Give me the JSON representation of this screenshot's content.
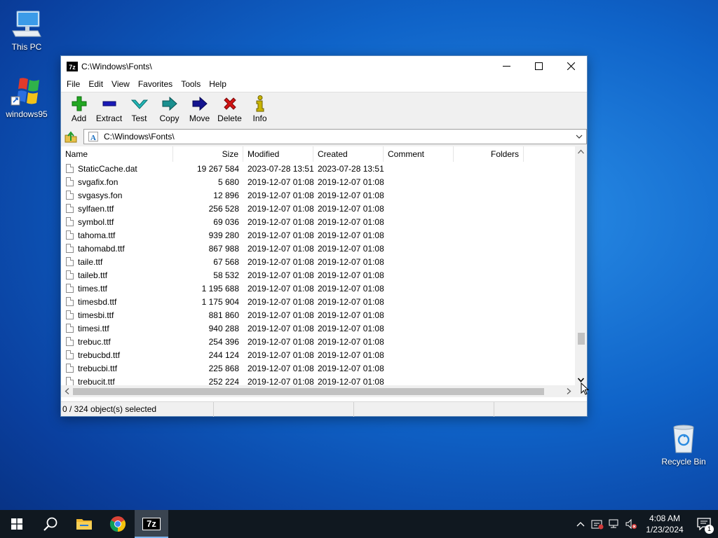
{
  "desktop": {
    "icons": [
      {
        "label": "This PC"
      },
      {
        "label": "windows95"
      },
      {
        "label": "Recycle Bin"
      }
    ]
  },
  "window": {
    "title": "C:\\Windows\\Fonts\\",
    "app_icon_text": "7z",
    "menu": [
      "File",
      "Edit",
      "View",
      "Favorites",
      "Tools",
      "Help"
    ],
    "toolbar": [
      {
        "label": "Add",
        "icon": "plus-icon",
        "color": "#22a822"
      },
      {
        "label": "Extract",
        "icon": "minus-icon",
        "color": "#1a1ab8"
      },
      {
        "label": "Test",
        "icon": "check-icon",
        "color": "#23b8b8"
      },
      {
        "label": "Copy",
        "icon": "copy-arrow-icon",
        "color": "#1a8f8f"
      },
      {
        "label": "Move",
        "icon": "move-arrow-icon",
        "color": "#14148f"
      },
      {
        "label": "Delete",
        "icon": "x-icon",
        "color": "#d21414"
      },
      {
        "label": "Info",
        "icon": "info-icon",
        "color": "#c9b400"
      }
    ],
    "address": "C:\\Windows\\Fonts\\",
    "columns": [
      "Name",
      "Size",
      "Modified",
      "Created",
      "Comment",
      "Folders"
    ],
    "rows": [
      {
        "name": "StaticCache.dat",
        "size": "19 267 584",
        "modified": "2023-07-28 13:51",
        "created": "2023-07-28 13:51"
      },
      {
        "name": "svgafix.fon",
        "size": "5 680",
        "modified": "2019-12-07 01:08",
        "created": "2019-12-07 01:08"
      },
      {
        "name": "svgasys.fon",
        "size": "12 896",
        "modified": "2019-12-07 01:08",
        "created": "2019-12-07 01:08"
      },
      {
        "name": "sylfaen.ttf",
        "size": "256 528",
        "modified": "2019-12-07 01:08",
        "created": "2019-12-07 01:08"
      },
      {
        "name": "symbol.ttf",
        "size": "69 036",
        "modified": "2019-12-07 01:08",
        "created": "2019-12-07 01:08"
      },
      {
        "name": "tahoma.ttf",
        "size": "939 280",
        "modified": "2019-12-07 01:08",
        "created": "2019-12-07 01:08"
      },
      {
        "name": "tahomabd.ttf",
        "size": "867 988",
        "modified": "2019-12-07 01:08",
        "created": "2019-12-07 01:08"
      },
      {
        "name": "taile.ttf",
        "size": "67 568",
        "modified": "2019-12-07 01:08",
        "created": "2019-12-07 01:08"
      },
      {
        "name": "taileb.ttf",
        "size": "58 532",
        "modified": "2019-12-07 01:08",
        "created": "2019-12-07 01:08"
      },
      {
        "name": "times.ttf",
        "size": "1 195 688",
        "modified": "2019-12-07 01:08",
        "created": "2019-12-07 01:08"
      },
      {
        "name": "timesbd.ttf",
        "size": "1 175 904",
        "modified": "2019-12-07 01:08",
        "created": "2019-12-07 01:08"
      },
      {
        "name": "timesbi.ttf",
        "size": "881 860",
        "modified": "2019-12-07 01:08",
        "created": "2019-12-07 01:08"
      },
      {
        "name": "timesi.ttf",
        "size": "940 288",
        "modified": "2019-12-07 01:08",
        "created": "2019-12-07 01:08"
      },
      {
        "name": "trebuc.ttf",
        "size": "254 396",
        "modified": "2019-12-07 01:08",
        "created": "2019-12-07 01:08"
      },
      {
        "name": "trebucbd.ttf",
        "size": "244 124",
        "modified": "2019-12-07 01:08",
        "created": "2019-12-07 01:08"
      },
      {
        "name": "trebucbi.ttf",
        "size": "225 868",
        "modified": "2019-12-07 01:08",
        "created": "2019-12-07 01:08"
      },
      {
        "name": "trebucit.ttf",
        "size": "252 224",
        "modified": "2019-12-07 01:08",
        "created": "2019-12-07 01:08"
      }
    ],
    "status": "0 / 324 object(s) selected"
  },
  "taskbar": {
    "apps": [
      {
        "icon": "start-icon"
      },
      {
        "icon": "search-icon"
      },
      {
        "icon": "file-explorer-icon"
      },
      {
        "icon": "chrome-icon"
      },
      {
        "icon": "7zip-icon",
        "text": "7z",
        "active": true
      }
    ],
    "time": "4:08 AM",
    "date": "1/23/2024",
    "notification_count": "1"
  }
}
